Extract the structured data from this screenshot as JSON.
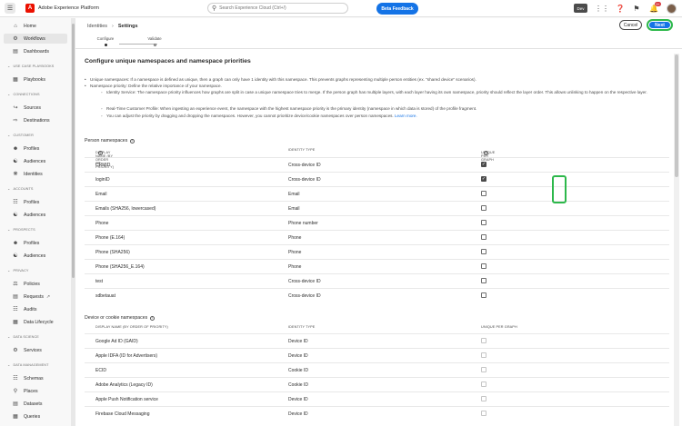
{
  "topbar": {
    "menu_icon": "hamburger-icon",
    "brand_logo_letter": "A",
    "brand_name": "Adobe Experience Platform",
    "search_placeholder": "Search Experience Cloud (Ctrl+/)",
    "feedback_label": "Beta Feedback",
    "sandbox_label": "Dev",
    "notification_count": "9+"
  },
  "sidebar": {
    "items_top": [
      {
        "label": "Home",
        "icon": "home-icon"
      },
      {
        "label": "Workflows",
        "icon": "workflow-icon"
      },
      {
        "label": "Dashboards",
        "icon": "dashboard-icon"
      }
    ],
    "sections": [
      {
        "title": "USE CASE PLAYBOOKS",
        "items": [
          {
            "label": "Playbooks",
            "icon": "playbook-icon"
          }
        ]
      },
      {
        "title": "CONNECTIONS",
        "items": [
          {
            "label": "Sources",
            "icon": "sources-icon"
          },
          {
            "label": "Destinations",
            "icon": "destinations-icon"
          }
        ]
      },
      {
        "title": "CUSTOMER",
        "items": [
          {
            "label": "Profiles",
            "icon": "profile-icon"
          },
          {
            "label": "Audiences",
            "icon": "audiences-icon"
          },
          {
            "label": "Identities",
            "icon": "identities-icon"
          }
        ]
      },
      {
        "title": "ACCOUNTS",
        "items": [
          {
            "label": "Profiles",
            "icon": "profile-icon"
          },
          {
            "label": "Audiences",
            "icon": "audiences-icon"
          }
        ]
      },
      {
        "title": "PROSPECTS",
        "items": [
          {
            "label": "Profiles",
            "icon": "profile-icon"
          },
          {
            "label": "Audiences",
            "icon": "audiences-icon"
          }
        ]
      },
      {
        "title": "PRIVACY",
        "items": [
          {
            "label": "Policies",
            "icon": "policies-icon"
          },
          {
            "label": "Requests",
            "icon": "requests-icon"
          },
          {
            "label": "Audits",
            "icon": "audits-icon"
          },
          {
            "label": "Data Lifecycle",
            "icon": "data-lifecycle-icon"
          }
        ]
      },
      {
        "title": "DATA SCIENCE",
        "items": [
          {
            "label": "Services",
            "icon": "services-icon"
          }
        ]
      },
      {
        "title": "DATA MANAGEMENT",
        "items": [
          {
            "label": "Schemas",
            "icon": "schemas-icon"
          },
          {
            "label": "Places",
            "icon": "places-icon"
          },
          {
            "label": "Datasets",
            "icon": "datasets-icon"
          },
          {
            "label": "Queries",
            "icon": "queries-icon"
          }
        ]
      }
    ]
  },
  "header": {
    "breadcrumb_parent": "Identities",
    "breadcrumb_current": "Settings",
    "cancel_label": "Cancel",
    "next_label": "Next"
  },
  "steps": [
    {
      "label": "Configure"
    },
    {
      "label": "Validate"
    }
  ],
  "main": {
    "title": "Configure unique namespaces and namespace priorities",
    "bullet1": "Unique namespaces: If a namespace is defined as unique, then a graph can only have 1 identity with this namespace. This prevents graphs representing multiple person entities (ex. \"shared device\" scenarios).",
    "bullet2": "Namespace priority: Define the relative importance of your namespace.",
    "sub1": "Identity Service: The namespace priority influences how graphs are split in case a unique namespace tries to merge. If the person graph has multiple layers, with each layer having its own namespace, priority should reflect the layer order. This allows unlinking to happen on the respective layer.",
    "sub2": "Real-Time Customer Profile: When ingesting an experience event, the namespace with the highest namespace priority is the primary identity (namespace in which data is stored) of the profile fragment.",
    "sub3": "You can adjust the priority by dragging and dropping the namespaces. However, you cannot prioritize device/cookie namespaces over person namespaces.",
    "learn_more": "Learn more.",
    "person": {
      "title": "Person namespaces",
      "col1": "DISPLAY NAME (BY ORDER OF PRIORITY)",
      "col2": "IDENTITY TYPE",
      "col3": "UNIQUE PER GRAPH",
      "rows": [
        {
          "name": "CRMID",
          "type": "Cross-device ID",
          "unique": true
        },
        {
          "name": "loginID",
          "type": "Cross-device ID",
          "unique": true
        },
        {
          "name": "Email",
          "type": "Email",
          "unique": false
        },
        {
          "name": "Emails (SHA256, lowercased)",
          "type": "Email",
          "unique": false
        },
        {
          "name": "Phone",
          "type": "Phone number",
          "unique": false
        },
        {
          "name": "Phone (E.164)",
          "type": "Phone",
          "unique": false
        },
        {
          "name": "Phone (SHA256)",
          "type": "Phone",
          "unique": false
        },
        {
          "name": "Phone (SHA256_E.164)",
          "type": "Phone",
          "unique": false
        },
        {
          "name": "test",
          "type": "Cross-device ID",
          "unique": false
        },
        {
          "name": "sdbetauat",
          "type": "Cross-device ID",
          "unique": false
        }
      ]
    },
    "device": {
      "title": "Device or cookie namespaces",
      "col1": "DISPLAY NAME (BY ORDER OF PRIORITY)",
      "col2": "IDENTITY TYPE",
      "col3": "UNIQUE PER GRAPH",
      "rows": [
        {
          "name": "Google Ad ID (GAID)",
          "type": "Device ID"
        },
        {
          "name": "Apple IDFA (ID for Advertisers)",
          "type": "Device ID"
        },
        {
          "name": "ECID",
          "type": "Cookie ID"
        },
        {
          "name": "Adobe Analytics (Legacy ID)",
          "type": "Cookie ID"
        },
        {
          "name": "Apple Push Notification service",
          "type": "Device ID"
        },
        {
          "name": "Firebase Cloud Messaging",
          "type": "Device ID"
        }
      ]
    }
  }
}
